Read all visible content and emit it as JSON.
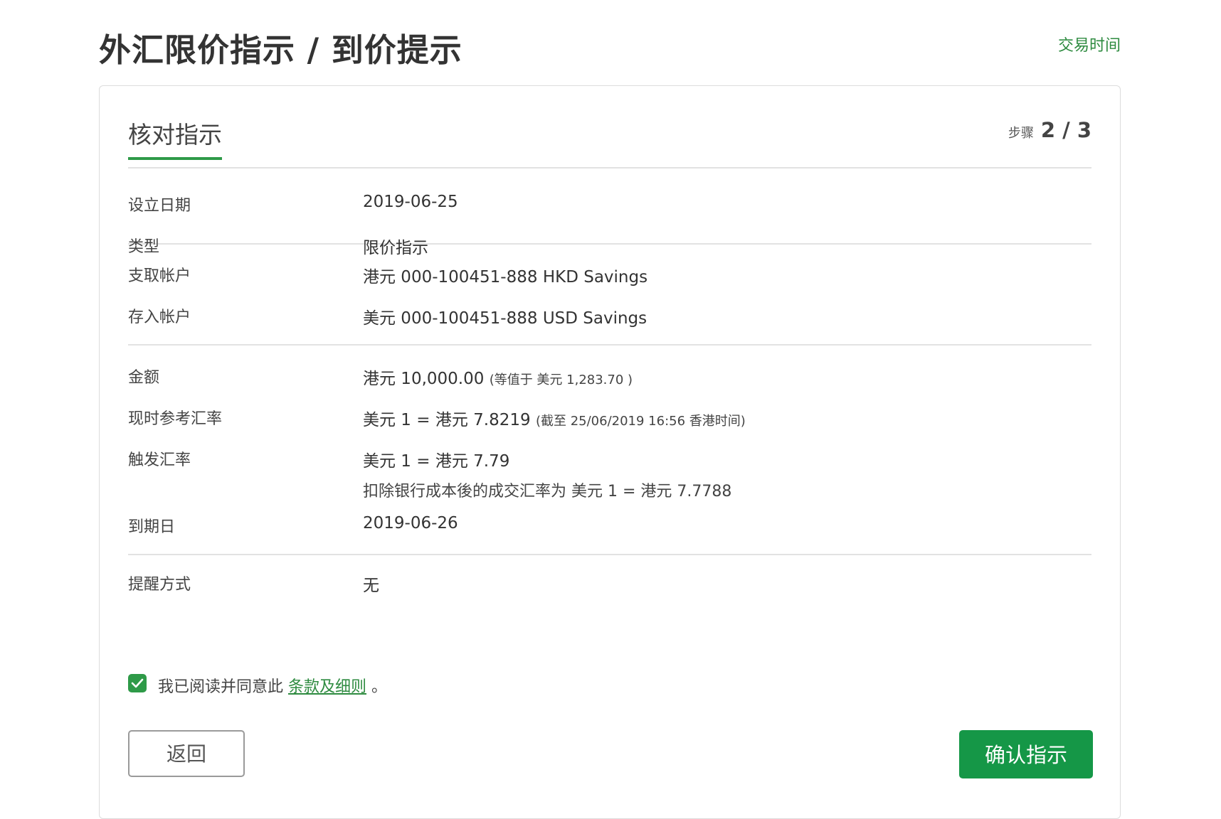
{
  "header": {
    "title": "外汇限价指示 / 到价提示",
    "trading_hours_link": "交易时间"
  },
  "card": {
    "title": "核对指示",
    "step_label": "步骤",
    "step_count": "2 / 3"
  },
  "details": {
    "setup_date": {
      "label": "设立日期",
      "value": "2019-06-25"
    },
    "type": {
      "label": "类型",
      "value": "限价指示"
    },
    "debit_account": {
      "label": "支取帐户",
      "value": "港元 000-100451-888 HKD Savings"
    },
    "credit_account": {
      "label": "存入帐户",
      "value": "美元 000-100451-888 USD Savings"
    },
    "amount": {
      "label": "金额",
      "value": "港元 10,000.00",
      "note": "(等值于 美元 1,283.70 )"
    },
    "current_rate": {
      "label": "现时参考汇率",
      "value": "美元 1 = 港元 7.8219",
      "note": "(截至 25/06/2019 16:56 香港时间)"
    },
    "trigger_rate": {
      "label": "触发汇率",
      "value": "美元 1 = 港元 7.79",
      "sub": "扣除银行成本後的成交汇率为 美元 1 = 港元 7.7788"
    },
    "expiry_date": {
      "label": "到期日",
      "value": "2019-06-26"
    },
    "reminder": {
      "label": "提醒方式",
      "value": "无"
    }
  },
  "agreement": {
    "checked": true,
    "text": "我已阅读并同意此 ",
    "link": "条款及细则",
    "suffix": " 。"
  },
  "actions": {
    "back": "返回",
    "confirm": "确认指示"
  },
  "colors": {
    "accent": "#2e9a48",
    "button": "#159747",
    "link": "#2e8b40"
  }
}
